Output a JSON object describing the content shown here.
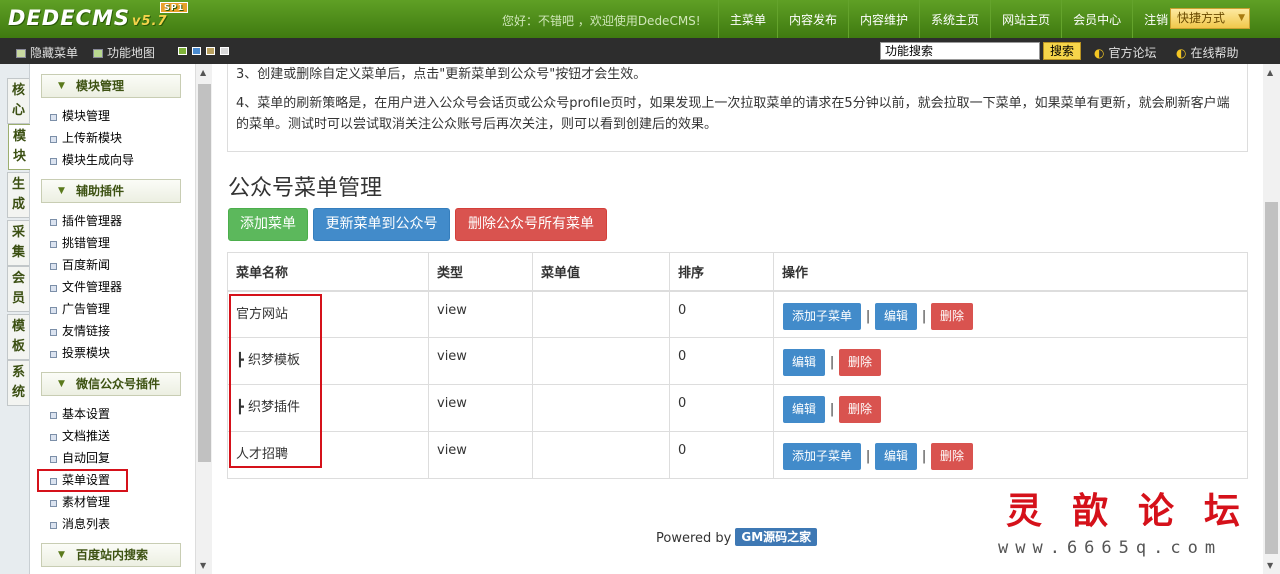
{
  "header": {
    "logo": "DEDECMS",
    "version": "v5.7",
    "sp_badge": "SP1",
    "welcome": "您好：不错吧 ，欢迎使用DedeCMS!",
    "nav": [
      "主菜单",
      "内容发布",
      "内容维护",
      "系统主页",
      "网站主页",
      "会员中心",
      "注销"
    ],
    "quick_label": "快捷方式"
  },
  "subbar": {
    "hide_menu": "隐藏菜单",
    "site_map": "功能地图",
    "search_value": "功能搜索",
    "search_button": "搜索",
    "forum_link": "官方论坛",
    "help_link": "在线帮助",
    "skin_colors": [
      "#7fb23a",
      "#4a8bd0",
      "#b8a060",
      "#d8d8d8"
    ]
  },
  "vtabs": [
    "核心",
    "模块",
    "生成",
    "采集",
    "会员",
    "模板",
    "系统"
  ],
  "sidebar": {
    "groups": [
      {
        "title": "模块管理",
        "items": [
          "模块管理",
          "上传新模块",
          "模块生成向导"
        ]
      },
      {
        "title": "辅助插件",
        "items": [
          "插件管理器",
          "挑错管理",
          "百度新闻",
          "文件管理器",
          "广告管理",
          "友情链接",
          "投票模块"
        ]
      },
      {
        "title": "微信公众号插件",
        "items": [
          "基本设置",
          "文档推送",
          "自动回复",
          "菜单设置",
          "素材管理",
          "消息列表"
        ]
      },
      {
        "title": "百度站内搜索",
        "items": []
      }
    ]
  },
  "notice": {
    "line3": "3、创建或删除自定义菜单后，点击\"更新菜单到公众号\"按钮才会生效。",
    "line4": "4、菜单的刷新策略是，在用户进入公众号会话页或公众号profile页时，如果发现上一次拉取菜单的请求在5分钟以前，就会拉取一下菜单，如果菜单有更新，就会刷新客户端的菜单。测试时可以尝试取消关注公众账号后再次关注，则可以看到创建后的效果。"
  },
  "page_title": "公众号菜单管理",
  "actions": {
    "add": "添加菜单",
    "update": "更新菜单到公众号",
    "delete_all": "删除公众号所有菜单"
  },
  "table": {
    "headers": [
      "菜单名称",
      "类型",
      "菜单值",
      "排序",
      "操作"
    ],
    "rows": [
      {
        "name": "官方网站",
        "type": "view",
        "value": "",
        "order": "0",
        "ops": [
          "添加子菜单",
          "编辑",
          "删除"
        ]
      },
      {
        "name": "┣ 织梦模板",
        "type": "view",
        "value": "",
        "order": "0",
        "ops": [
          "编辑",
          "删除"
        ]
      },
      {
        "name": "┣ 织梦插件",
        "type": "view",
        "value": "",
        "order": "0",
        "ops": [
          "编辑",
          "删除"
        ]
      },
      {
        "name": "人才招聘",
        "type": "view",
        "value": "",
        "order": "0",
        "ops": [
          "添加子菜单",
          "编辑",
          "删除"
        ]
      }
    ]
  },
  "footer": {
    "powered": "Powered by",
    "brand": "GM源码之家"
  },
  "watermark": {
    "title": "灵歆论坛",
    "url": "www.6665q.com"
  }
}
